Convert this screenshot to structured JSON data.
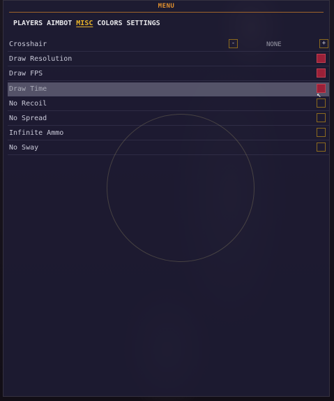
{
  "menu": {
    "title": "MENU",
    "tabs": [
      {
        "label": "PLAYERS",
        "active": false
      },
      {
        "label": "AIMBOT",
        "active": false
      },
      {
        "label": "MISC",
        "active": true
      },
      {
        "label": "COLORS",
        "active": false
      },
      {
        "label": "SETTINGS",
        "active": false
      }
    ]
  },
  "crosshair": {
    "label": "Crosshair",
    "decrement": "-",
    "value": "NONE",
    "increment": "+"
  },
  "options": [
    {
      "label": "Draw Resolution",
      "checked": true
    },
    {
      "label": "Draw FPS",
      "checked": true
    },
    {
      "label": "Draw Time",
      "checked": true
    },
    {
      "label": "No Recoil",
      "checked": false
    },
    {
      "label": "No Spread",
      "checked": false
    },
    {
      "label": "Infinite Ammo",
      "checked": false
    },
    {
      "label": "No Sway",
      "checked": false
    }
  ],
  "colors": {
    "accent": "#e8b32a",
    "title": "#e0902e",
    "checked": "#9a2038",
    "checkbox_border": "#8c6a1e",
    "panel": "#1e1c34"
  }
}
